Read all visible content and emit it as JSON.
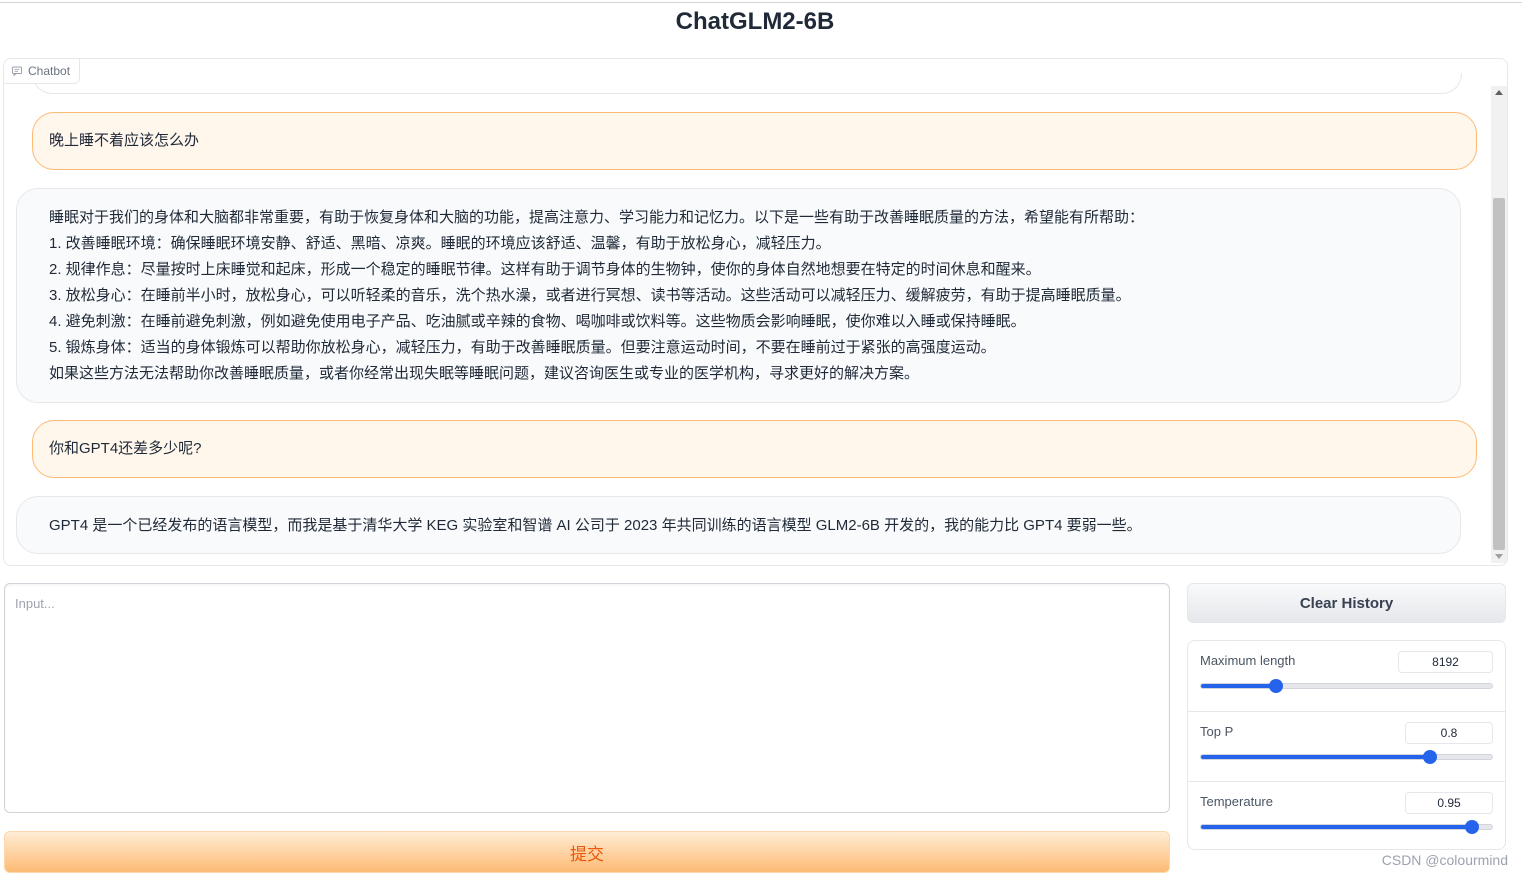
{
  "app": {
    "title": "ChatGLM2-6B"
  },
  "chatbot": {
    "label": "Chatbot",
    "messages": [
      {
        "role": "user",
        "text": "晚上睡不着应该怎么办"
      },
      {
        "role": "bot",
        "lines": [
          "睡眠对于我们的身体和大脑都非常重要，有助于恢复身体和大脑的功能，提高注意力、学习能力和记忆力。以下是一些有助于改善睡眠质量的方法，希望能有所帮助：",
          "1. 改善睡眠环境：确保睡眠环境安静、舒适、黑暗、凉爽。睡眠的环境应该舒适、温馨，有助于放松身心，减轻压力。",
          "2. 规律作息：尽量按时上床睡觉和起床，形成一个稳定的睡眠节律。这样有助于调节身体的生物钟，使你的身体自然地想要在特定的时间休息和醒来。",
          "3. 放松身心：在睡前半小时，放松身心，可以听轻柔的音乐，洗个热水澡，或者进行冥想、读书等活动。这些活动可以减轻压力、缓解疲劳，有助于提高睡眠质量。",
          "4. 避免刺激：在睡前避免刺激，例如避免使用电子产品、吃油腻或辛辣的食物、喝咖啡或饮料等。这些物质会影响睡眠，使你难以入睡或保持睡眠。",
          "5. 锻炼身体：适当的身体锻炼可以帮助你放松身心，减轻压力，有助于改善睡眠质量。但要注意运动时间，不要在睡前过于紧张的高强度运动。",
          "如果这些方法无法帮助你改善睡眠质量，或者你经常出现失眠等睡眠问题，建议咨询医生或专业的医学机构，寻求更好的解决方案。"
        ]
      },
      {
        "role": "user",
        "text": "你和GPT4还差多少呢?"
      },
      {
        "role": "bot",
        "lines": [
          "GPT4 是一个已经发布的语言模型，而我是基于清华大学 KEG 实验室和智谱 AI 公司于 2023 年共同训练的语言模型 GLM2-6B 开发的，我的能力比 GPT4 要弱一些。"
        ]
      }
    ]
  },
  "input": {
    "placeholder": "Input...",
    "value": ""
  },
  "submit_label": "提交",
  "clear_label": "Clear History",
  "sliders": [
    {
      "label": "Maximum length",
      "value": "8192",
      "fraction": 0.26
    },
    {
      "label": "Top P",
      "value": "0.8",
      "fraction": 0.786
    },
    {
      "label": "Temperature",
      "value": "0.95",
      "fraction": 0.93
    }
  ],
  "colors": {
    "accent": "#2563eb",
    "user_bubble": "#fff6ec",
    "user_border": "#fdba74",
    "submit_text": "#ea580c"
  },
  "watermark": "CSDN @colourmind"
}
